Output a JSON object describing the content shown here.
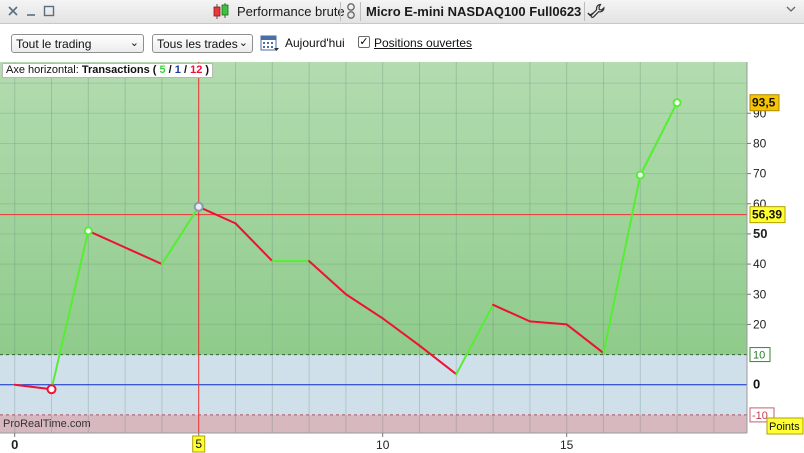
{
  "titlebar": {
    "performance_label": "Performance brute",
    "instrument": "Micro E-mini NASDAQ100 Full0623 ⌄"
  },
  "toolbar": {
    "trading_select": "Tout le trading",
    "trades_select": "Tous les trades",
    "today_label": "Aujourd'hui",
    "open_positions_label": "Positions ouvertes",
    "open_positions_checked": true
  },
  "chart_header": {
    "prefix": "Axe horizontal:",
    "mode": "Transactions",
    "open_paren": "(",
    "wins": "5",
    "slash1": "/",
    "neutral": "1",
    "slash2": "/",
    "losses": "12",
    "close_paren": ")"
  },
  "watermark": "ProRealTime.com",
  "colors": {
    "gain_line": "#55ee33",
    "loss_line": "#ee1133",
    "zero_line": "#1030d0",
    "cursor_line": "#ee3333",
    "upper_zone": "#a8d8a4",
    "middle_zone": "#d0e0ea",
    "lower_zone": "#d7b8bf",
    "last_value_badge": "#f7c400",
    "cursor_value_badge": "#ffff33"
  },
  "chart_data": {
    "type": "line",
    "title": "",
    "xlabel": "",
    "ylabel": "Points",
    "x": [
      0,
      1,
      2,
      3,
      4,
      5,
      6,
      7,
      8,
      9,
      10,
      11,
      12,
      13,
      14,
      15,
      16,
      17,
      18
    ],
    "y": [
      0,
      -1.5,
      51,
      45.5,
      40,
      59,
      53.5,
      41,
      41,
      30,
      22,
      13,
      3.5,
      26.5,
      21,
      20,
      10.5,
      69.5,
      93.5
    ],
    "xlim": [
      -0.4,
      19.9
    ],
    "ylim": [
      -16,
      107
    ],
    "x_ticks": [
      "0",
      "5",
      "10",
      "15"
    ],
    "x_tick_values": [
      0,
      5,
      10,
      15
    ],
    "y_ticks": [
      "20",
      "30",
      "40",
      "50",
      "60",
      "70",
      "80",
      "90"
    ],
    "y_tick_values": [
      20,
      30,
      40,
      50,
      60,
      70,
      80,
      90
    ],
    "zero_label": "0",
    "upper_threshold": 10,
    "upper_threshold_label": "10",
    "lower_threshold": -10,
    "lower_threshold_label": "-10",
    "last_value": 93.5,
    "last_value_label": "93,5",
    "cursor_value": 56.39,
    "cursor_value_label": "56,39",
    "cursor_x": 5,
    "cursor_x_label": "5",
    "unit_label": "Points",
    "grid": true
  }
}
